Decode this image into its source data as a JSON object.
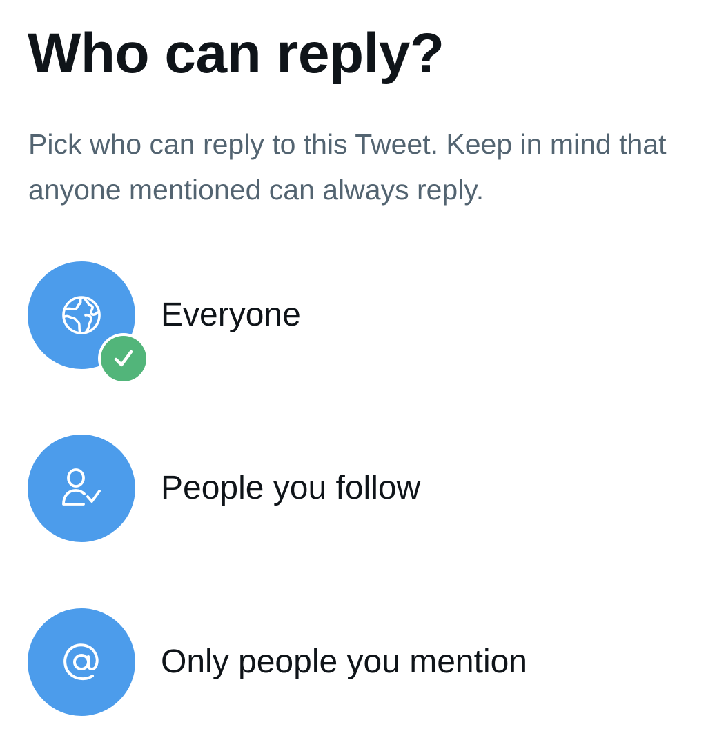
{
  "header": {
    "title": "Who can reply?",
    "subtitle": "Pick who can reply to this Tweet. Keep in mind that anyone mentioned can always reply."
  },
  "options": [
    {
      "label": "Everyone",
      "icon": "globe-icon",
      "selected": true
    },
    {
      "label": "People you follow",
      "icon": "person-check-icon",
      "selected": false
    },
    {
      "label": "Only people you mention",
      "icon": "at-sign-icon",
      "selected": false
    }
  ],
  "colors": {
    "icon_background": "#4c9ceb",
    "selected_badge": "#52b57a",
    "title_text": "#0f1419",
    "subtitle_text": "#536471"
  }
}
